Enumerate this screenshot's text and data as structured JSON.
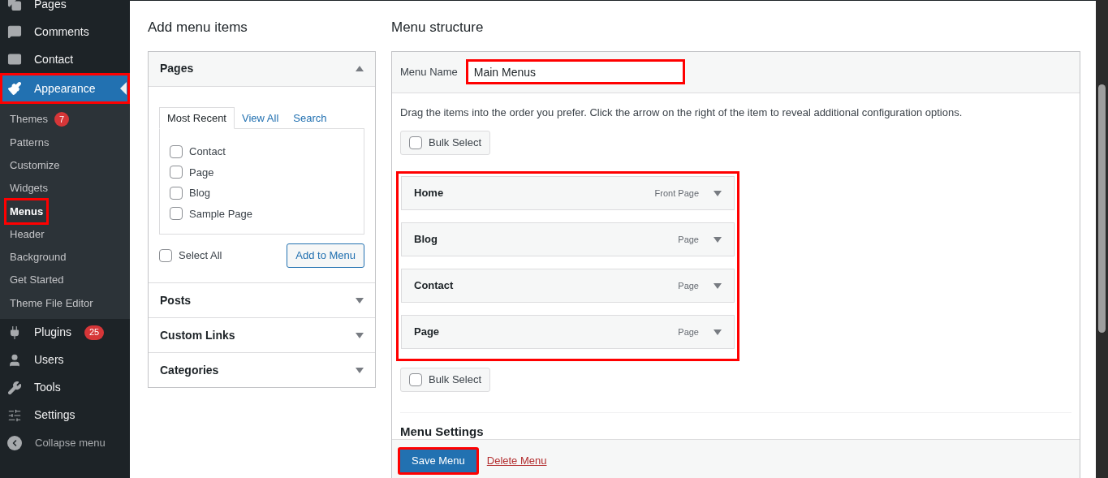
{
  "sidebar": {
    "items": [
      {
        "label": "Pages",
        "selected": false,
        "highlighted": false
      },
      {
        "label": "Comments",
        "selected": false,
        "highlighted": false
      },
      {
        "label": "Contact",
        "selected": false,
        "highlighted": false
      },
      {
        "label": "Appearance",
        "selected": true,
        "highlighted": true,
        "children": [
          {
            "label": "Themes",
            "selected": false,
            "highlighted": false,
            "badge": "7"
          },
          {
            "label": "Patterns",
            "selected": false,
            "highlighted": false
          },
          {
            "label": "Customize",
            "selected": false,
            "highlighted": false
          },
          {
            "label": "Widgets",
            "selected": false,
            "highlighted": false
          },
          {
            "label": "Menus",
            "selected": true,
            "highlighted": true
          },
          {
            "label": "Header",
            "selected": false,
            "highlighted": false
          },
          {
            "label": "Background",
            "selected": false,
            "highlighted": false
          },
          {
            "label": "Get Started",
            "selected": false,
            "highlighted": false
          },
          {
            "label": "Theme File Editor",
            "selected": false,
            "highlighted": false
          }
        ]
      },
      {
        "label": "Plugins",
        "selected": false,
        "highlighted": false,
        "badge": "25"
      },
      {
        "label": "Users",
        "selected": false,
        "highlighted": false
      },
      {
        "label": "Tools",
        "selected": false,
        "highlighted": false
      },
      {
        "label": "Settings",
        "selected": false,
        "highlighted": false
      }
    ],
    "collapse": "Collapse menu"
  },
  "add_menu_items": {
    "title": "Add menu items",
    "sections": [
      {
        "title": "Pages",
        "expanded": true,
        "tabs": [
          {
            "label": "Most Recent",
            "selected": true
          },
          {
            "label": "View All",
            "selected": false
          },
          {
            "label": "Search",
            "selected": false
          }
        ],
        "options": [
          {
            "label": "Contact",
            "checked": false
          },
          {
            "label": "Page",
            "checked": false
          },
          {
            "label": "Blog",
            "checked": false
          },
          {
            "label": "Sample Page",
            "checked": false
          }
        ],
        "select_all": {
          "label": "Select All",
          "checked": false
        },
        "button": "Add to Menu"
      },
      {
        "title": "Posts",
        "expanded": false
      },
      {
        "title": "Custom Links",
        "expanded": false
      },
      {
        "title": "Categories",
        "expanded": false
      }
    ]
  },
  "menu_structure": {
    "title": "Menu structure",
    "menu_name_label": "Menu Name",
    "menu_name": "Main Menus",
    "menu_name_highlighted": true,
    "instructions": "Drag the items into the order you prefer. Click the arrow on the right of the item to reveal additional configuration options.",
    "bulk_select": [
      {
        "label": "Bulk Select",
        "checked": false
      },
      {
        "label": "Bulk Select",
        "checked": false
      }
    ],
    "items_highlighted": true,
    "items": [
      {
        "title": "Home",
        "type": "Front Page"
      },
      {
        "title": "Blog",
        "type": "Page"
      },
      {
        "title": "Contact",
        "type": "Page"
      },
      {
        "title": "Page",
        "type": "Page"
      }
    ],
    "settings_heading": "Menu Settings",
    "save_button": "Save Menu",
    "save_highlighted": true,
    "delete_link": "Delete Menu"
  }
}
